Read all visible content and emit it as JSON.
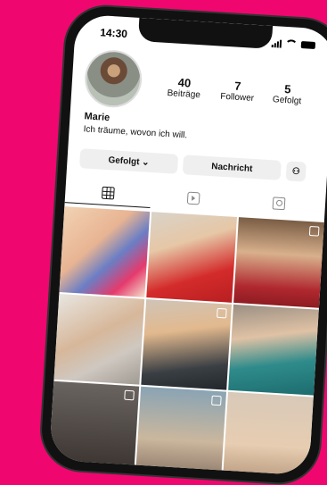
{
  "status_bar": {
    "time": "14:30"
  },
  "profile": {
    "name": "Marie",
    "bio": "Ich träume, wovon ich will.",
    "stats": [
      {
        "num": "40",
        "label": "Beiträge"
      },
      {
        "num": "7",
        "label": "Follower"
      },
      {
        "num": "5",
        "label": "Gefolgt"
      }
    ]
  },
  "actions": {
    "follow_label": "Gefolgt ⌄",
    "message_label": "Nachricht"
  },
  "tabs": [
    "grid-icon",
    "reels-icon",
    "tagged-icon"
  ],
  "posts": [
    {
      "icon": ""
    },
    {
      "icon": ""
    },
    {
      "icon": "reels-icon"
    },
    {
      "icon": ""
    },
    {
      "icon": "reels-icon"
    },
    {
      "icon": ""
    },
    {
      "icon": "reels-icon"
    },
    {
      "icon": "reels-icon"
    },
    {
      "icon": ""
    }
  ],
  "colors": {
    "background": "#f0066f",
    "phone_frame": "#111111"
  }
}
